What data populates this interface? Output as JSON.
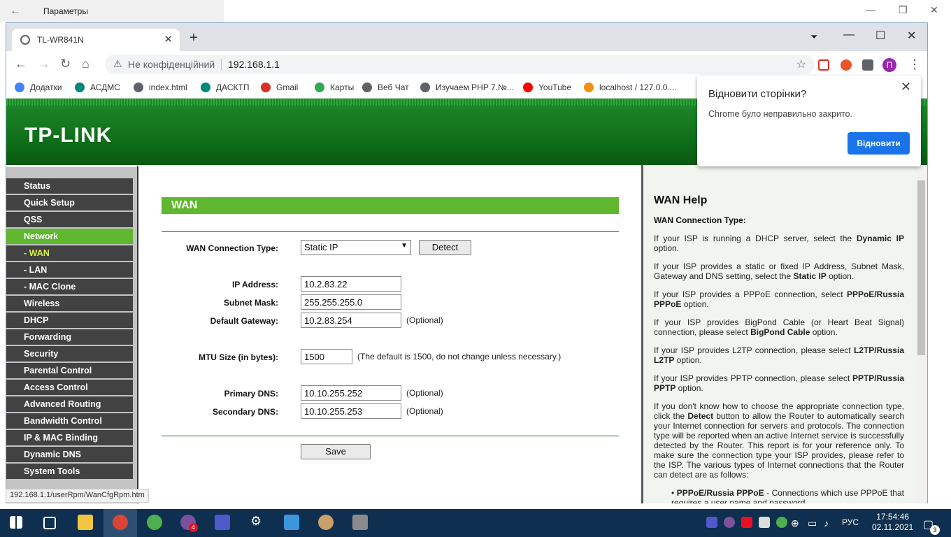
{
  "settings": {
    "title": "Параметры"
  },
  "tab": {
    "title": "TL-WR841N"
  },
  "omnibox": {
    "security": "Не конфіденційний",
    "url": "192.168.1.1"
  },
  "bookmarks": [
    {
      "label": "Додатки",
      "color": "#4285f4"
    },
    {
      "label": "АСДМС",
      "color": "#00897b"
    },
    {
      "label": "index.html",
      "color": "#5f6368"
    },
    {
      "label": "ДАСКТП",
      "color": "#00897b"
    },
    {
      "label": "Gmail",
      "color": "#d93025"
    },
    {
      "label": "Карты",
      "color": "#34a853"
    },
    {
      "label": "Веб Чат",
      "color": "#5f6368"
    },
    {
      "label": "Изучаем PHP 7.№...",
      "color": "#5f6368"
    },
    {
      "label": "YouTube",
      "color": "#ff0000"
    },
    {
      "label": "localhost / 127.0.0....",
      "color": "#f29111"
    }
  ],
  "router": {
    "brand": "TP-LINK",
    "menu": [
      {
        "label": "Status"
      },
      {
        "label": "Quick Setup"
      },
      {
        "label": "QSS"
      },
      {
        "label": "Network",
        "active": true
      },
      {
        "label": "- WAN",
        "sub": true,
        "current": true
      },
      {
        "label": "- LAN",
        "sub": true
      },
      {
        "label": "- MAC Clone",
        "sub": true
      },
      {
        "label": "Wireless"
      },
      {
        "label": "DHCP"
      },
      {
        "label": "Forwarding"
      },
      {
        "label": "Security"
      },
      {
        "label": "Parental Control"
      },
      {
        "label": "Access Control"
      },
      {
        "label": "Advanced Routing"
      },
      {
        "label": "Bandwidth Control"
      },
      {
        "label": "IP & MAC Binding"
      },
      {
        "label": "Dynamic DNS"
      },
      {
        "label": "System Tools"
      }
    ],
    "wan": {
      "header": "WAN",
      "conn_type_label": "WAN Connection Type:",
      "conn_type_value": "Static IP",
      "detect_label": "Detect",
      "ip_label": "IP Address:",
      "ip_value": "10.2.83.22",
      "mask_label": "Subnet Mask:",
      "mask_value": "255.255.255.0",
      "gw_label": "Default Gateway:",
      "gw_value": "10.2.83.254",
      "optional": "(Optional)",
      "mtu_label": "MTU Size (in bytes):",
      "mtu_value": "1500",
      "mtu_note": "(The default is 1500, do not change unless necessary.)",
      "dns1_label": "Primary DNS:",
      "dns1_value": "10.10.255.252",
      "dns2_label": "Secondary DNS:",
      "dns2_value": "10.10.255.253",
      "save_label": "Save"
    },
    "help": {
      "title": "WAN Help",
      "subtitle": "WAN Connection Type:",
      "p1a": "If your ISP is running a DHCP server, select the ",
      "p1b": "Dynamic IP",
      "p1c": " option.",
      "p2a": "If your ISP provides a static or fixed IP Address, Subnet Mask, Gateway and DNS setting, select the ",
      "p2b": "Static IP",
      "p2c": " option.",
      "p3a": "If your ISP provides a PPPoE connection, select ",
      "p3b": "PPPoE/Russia PPPoE",
      "p3c": " option.",
      "p4a": "If your ISP provides BigPond Cable (or Heart Beat Signal) connection, please select ",
      "p4b": "BigPond Cable",
      "p4c": " option.",
      "p5a": "If your ISP provides L2TP connection, please select ",
      "p5b": "L2TP/Russia L2TP",
      "p5c": " option.",
      "p6a": "If your ISP provides PPTP connection, please select ",
      "p6b": "PPTP/Russia PPTP",
      "p6c": " option.",
      "p7a": "If you don't know how to choose the appropriate connection type, click the ",
      "p7b": "Detect",
      "p7c": " button to allow the Router to automatically search your Internet connection for servers and protocols. The connection type will be reported when an active Internet service is successfully detected by the Router. This report is for your reference only. To make sure the connection type your ISP provides, please refer to the ISP. The various types of Internet connections that the Router can detect are as follows:",
      "b1a": "PPPoE/Russia PPPoE",
      "b1c": " - Connections which use PPPoE that requires a user name and password."
    }
  },
  "popup": {
    "title": "Відновити сторінки?",
    "text": "Chrome було неправильно закрито.",
    "button": "Відновити"
  },
  "status_url": "192.168.1.1/userRpm/WanCfgRpm.htm",
  "taskbar": {
    "lang": "РУС",
    "time": "17:54:46",
    "date": "02.11.2021",
    "notif_count": "3",
    "viber_badge": "4"
  }
}
